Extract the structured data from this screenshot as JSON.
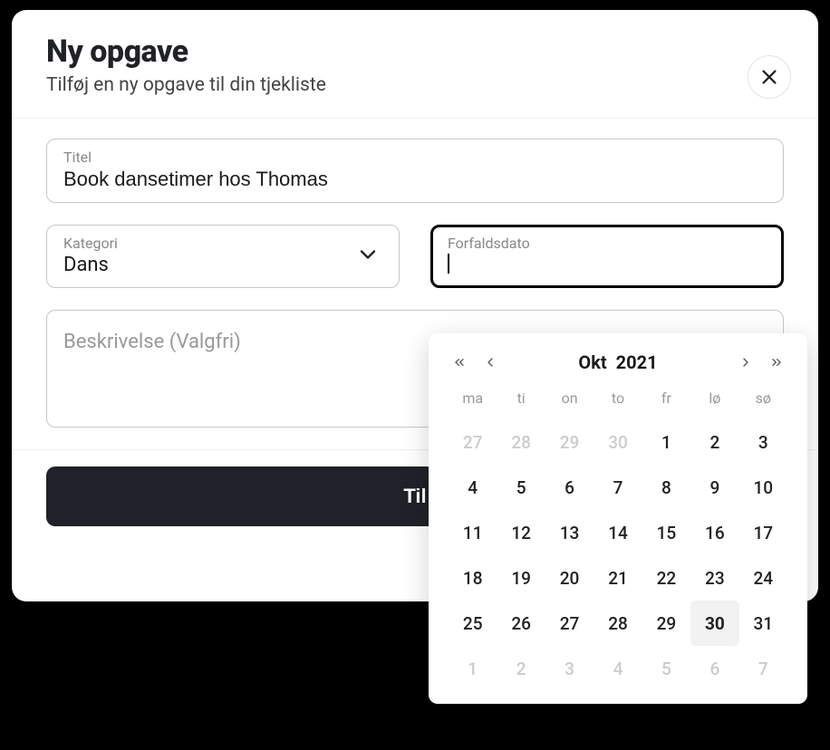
{
  "header": {
    "title": "Ny opgave",
    "subtitle": "Tilføj en ny opgave til din tjekliste"
  },
  "form": {
    "title_label": "Titel",
    "title_value": "Book dansetimer hos Thomas",
    "category_label": "Kategori",
    "category_value": "Dans",
    "due_label": "Forfaldsdato",
    "due_value": "",
    "description_placeholder": "Beskrivelse (Valgfri)"
  },
  "submit_label": "Til",
  "calendar": {
    "month": "Okt",
    "year": "2021",
    "dow": [
      "ma",
      "ti",
      "on",
      "to",
      "fr",
      "lø",
      "sø"
    ],
    "days": [
      {
        "n": 27,
        "outside": true
      },
      {
        "n": 28,
        "outside": true
      },
      {
        "n": 29,
        "outside": true
      },
      {
        "n": 30,
        "outside": true
      },
      {
        "n": 1
      },
      {
        "n": 2
      },
      {
        "n": 3
      },
      {
        "n": 4
      },
      {
        "n": 5
      },
      {
        "n": 6
      },
      {
        "n": 7
      },
      {
        "n": 8
      },
      {
        "n": 9
      },
      {
        "n": 10
      },
      {
        "n": 11
      },
      {
        "n": 12
      },
      {
        "n": 13
      },
      {
        "n": 14
      },
      {
        "n": 15
      },
      {
        "n": 16
      },
      {
        "n": 17
      },
      {
        "n": 18
      },
      {
        "n": 19
      },
      {
        "n": 20
      },
      {
        "n": 21
      },
      {
        "n": 22
      },
      {
        "n": 23
      },
      {
        "n": 24
      },
      {
        "n": 25
      },
      {
        "n": 26
      },
      {
        "n": 27
      },
      {
        "n": 28
      },
      {
        "n": 29
      },
      {
        "n": 30,
        "today": true
      },
      {
        "n": 31
      },
      {
        "n": 1,
        "outside": true
      },
      {
        "n": 2,
        "outside": true
      },
      {
        "n": 3,
        "outside": true
      },
      {
        "n": 4,
        "outside": true
      },
      {
        "n": 5,
        "outside": true
      },
      {
        "n": 6,
        "outside": true
      },
      {
        "n": 7,
        "outside": true
      }
    ]
  }
}
